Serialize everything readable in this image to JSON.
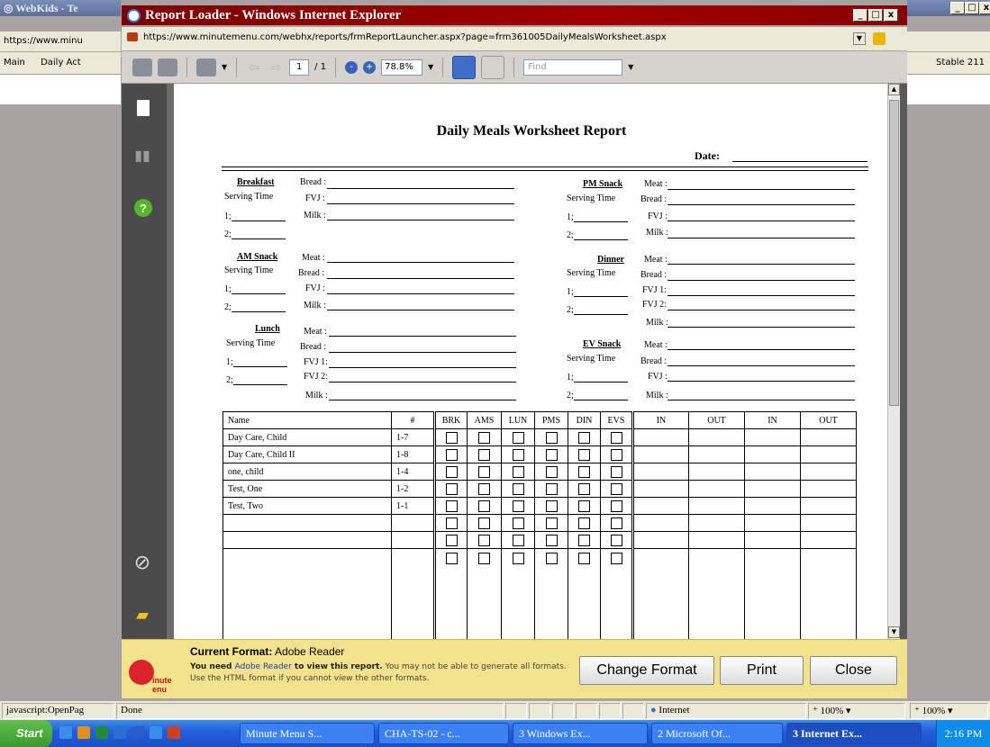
{
  "background_windows": {
    "left_title": "WebKids - Te",
    "left_url": "https://www.minu",
    "left_nav": [
      "Main",
      "Daily Act"
    ],
    "right_nav": "Stable 211"
  },
  "window": {
    "title": "Report Loader - Windows Internet Explorer",
    "url": "https://www.minutemenu.com/webhx/reports/frmReportLauncher.aspx?page=frm361005DailyMealsWorksheet.aspx"
  },
  "toolbar": {
    "page_current": "1",
    "page_total": "/ 1",
    "zoom": "78.8%",
    "find_placeholder": "Find"
  },
  "report": {
    "title": "Daily Meals Worksheet Report",
    "date_label": "Date:",
    "serving_time_label": "Serving Time",
    "slot1": "1;",
    "slot2": "2;",
    "sections": {
      "breakfast": {
        "heading": "Breakfast",
        "items": [
          "Bread :",
          "FVJ :",
          "Milk :"
        ]
      },
      "am_snack": {
        "heading": "AM Snack",
        "items": [
          "Meat :",
          "Bread :",
          "FVJ :",
          "Milk :"
        ]
      },
      "lunch": {
        "heading": "Lunch",
        "items": [
          "Meat :",
          "Bread :",
          "FVJ 1:",
          "FVJ 2:",
          "Milk :"
        ]
      },
      "pm_snack": {
        "heading": "PM Snack",
        "items": [
          "Meat :",
          "Bread :",
          "FVJ :",
          "Milk :"
        ]
      },
      "dinner": {
        "heading": "Dinner",
        "items": [
          "Meat :",
          "Bread :",
          "FVJ 1:",
          "FVJ 2:",
          "Milk :"
        ]
      },
      "ev_snack": {
        "heading": "EV Snack",
        "items": [
          "Meat :",
          "Bread :",
          "FVJ :",
          "Milk :"
        ]
      }
    },
    "table": {
      "headers": [
        "Name",
        "#",
        "BRK",
        "AMS",
        "LUN",
        "PMS",
        "DIN",
        "EVS",
        "IN",
        "OUT",
        "IN",
        "OUT"
      ],
      "rows": [
        {
          "name": "Day Care, Child",
          "num": "1-7"
        },
        {
          "name": "Day Care, Child II",
          "num": "1-8"
        },
        {
          "name": "one, child",
          "num": "1-4"
        },
        {
          "name": "Test, One",
          "num": "1-2"
        },
        {
          "name": "Test, Two",
          "num": "1-1"
        }
      ]
    }
  },
  "format_bar": {
    "current_label": "Current Format:",
    "current_value": "Adobe Reader",
    "msg_pre": "You need ",
    "msg_link": "Adobe Reader",
    "msg_mid": " to view this report.",
    "msg_post": "  You may not be able to generate all formats. Use the HTML format if you cannot view the other formats.",
    "logo_text": "inute enu",
    "buttons": {
      "change": "Change Format",
      "print": "Print",
      "close": "Close"
    }
  },
  "status": {
    "left_text": "javascript:OpenPag",
    "done": "Done",
    "zone": "Internet",
    "zoom": "100%",
    "zoom_right": "100%"
  },
  "taskbar": {
    "start": "Start",
    "tasks": [
      "Minute Menu S...",
      "CHA-TS-02 - c...",
      "3 Windows Ex...",
      "2 Microsoft Of...",
      "3 Internet Ex..."
    ],
    "clock": "2:16 PM"
  }
}
